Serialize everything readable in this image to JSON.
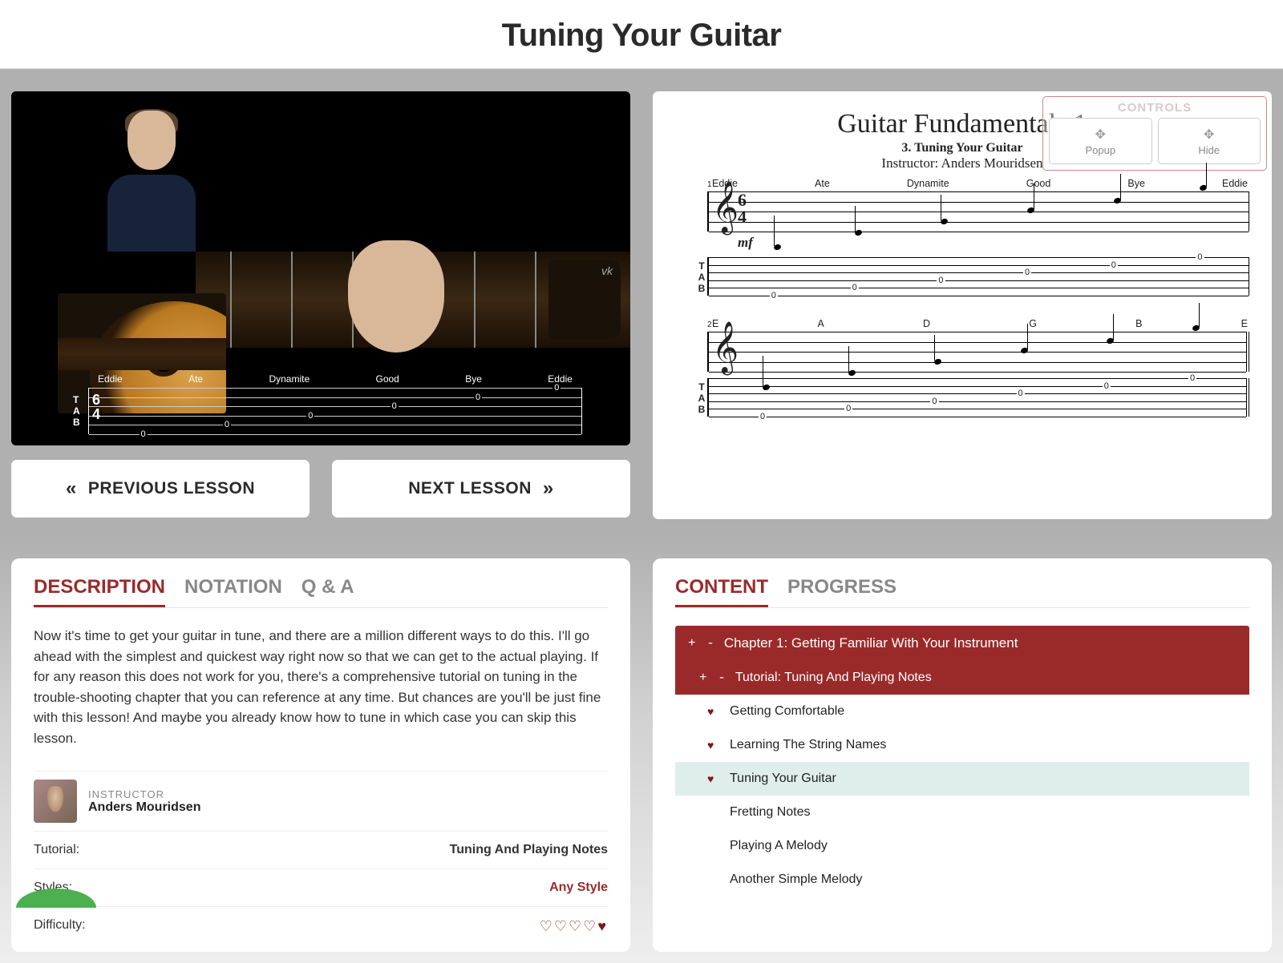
{
  "page": {
    "title": "Tuning Your Guitar"
  },
  "nav": {
    "prev": "PREVIOUS LESSON",
    "next": "NEXT LESSON"
  },
  "notation": {
    "title": "Guitar Fundamentals 1",
    "subtitle": "3. Tuning Your Guitar",
    "instructor_line": "Instructor: Anders Mouridsen",
    "bar1_labels": [
      "Eddie",
      "Ate",
      "Dynamite",
      "Good",
      "Bye",
      "Eddie"
    ],
    "bar2_labels": [
      "E",
      "A",
      "D",
      "G",
      "B",
      "E"
    ],
    "dynamic": "mf",
    "timesig_top": "6",
    "timesig_bot": "4",
    "controls": {
      "title": "CONTROLS",
      "popup": "Popup",
      "hide": "Hide"
    }
  },
  "video": {
    "labels": [
      "Eddie",
      "Ate",
      "Dynamite",
      "Good",
      "Bye",
      "Eddie"
    ],
    "timesig_top": "6",
    "timesig_bot": "4",
    "tab_letters": [
      "T",
      "A",
      "B"
    ]
  },
  "left_tabs": [
    "DESCRIPTION",
    "NOTATION",
    "Q & A"
  ],
  "description": "Now it's time to get your guitar in tune, and there are a million different ways to do this. I'll go ahead with the simplest and quickest way right now so that we can get to the actual playing. If for any reason this does not work for you, there's a comprehensive tutorial on tuning in the trouble-shooting chapter that you can reference at any time. But chances are you'll be just fine with this lesson! And maybe you already know how to tune in which case you can skip this lesson.",
  "instructor": {
    "label": "INSTRUCTOR",
    "name": "Anders Mouridsen"
  },
  "details": {
    "tutorial_label": "Tutorial:",
    "tutorial_value": "Tuning And Playing Notes",
    "styles_label": "Styles:",
    "styles_value": "Any Style",
    "difficulty_label": "Difficulty:"
  },
  "right_tabs": [
    "CONTENT",
    "PROGRESS"
  ],
  "content": {
    "chapter": "Chapter 1: Getting Familiar With Your Instrument",
    "tutorial": "Tutorial: Tuning And Playing Notes",
    "lessons": [
      {
        "title": "Getting Comfortable",
        "done": true,
        "active": false
      },
      {
        "title": "Learning The String Names",
        "done": true,
        "active": false
      },
      {
        "title": "Tuning Your Guitar",
        "done": true,
        "active": true
      },
      {
        "title": "Fretting Notes",
        "done": false,
        "active": false
      },
      {
        "title": "Playing A Melody",
        "done": false,
        "active": false
      },
      {
        "title": "Another Simple Melody",
        "done": false,
        "active": false
      }
    ]
  }
}
